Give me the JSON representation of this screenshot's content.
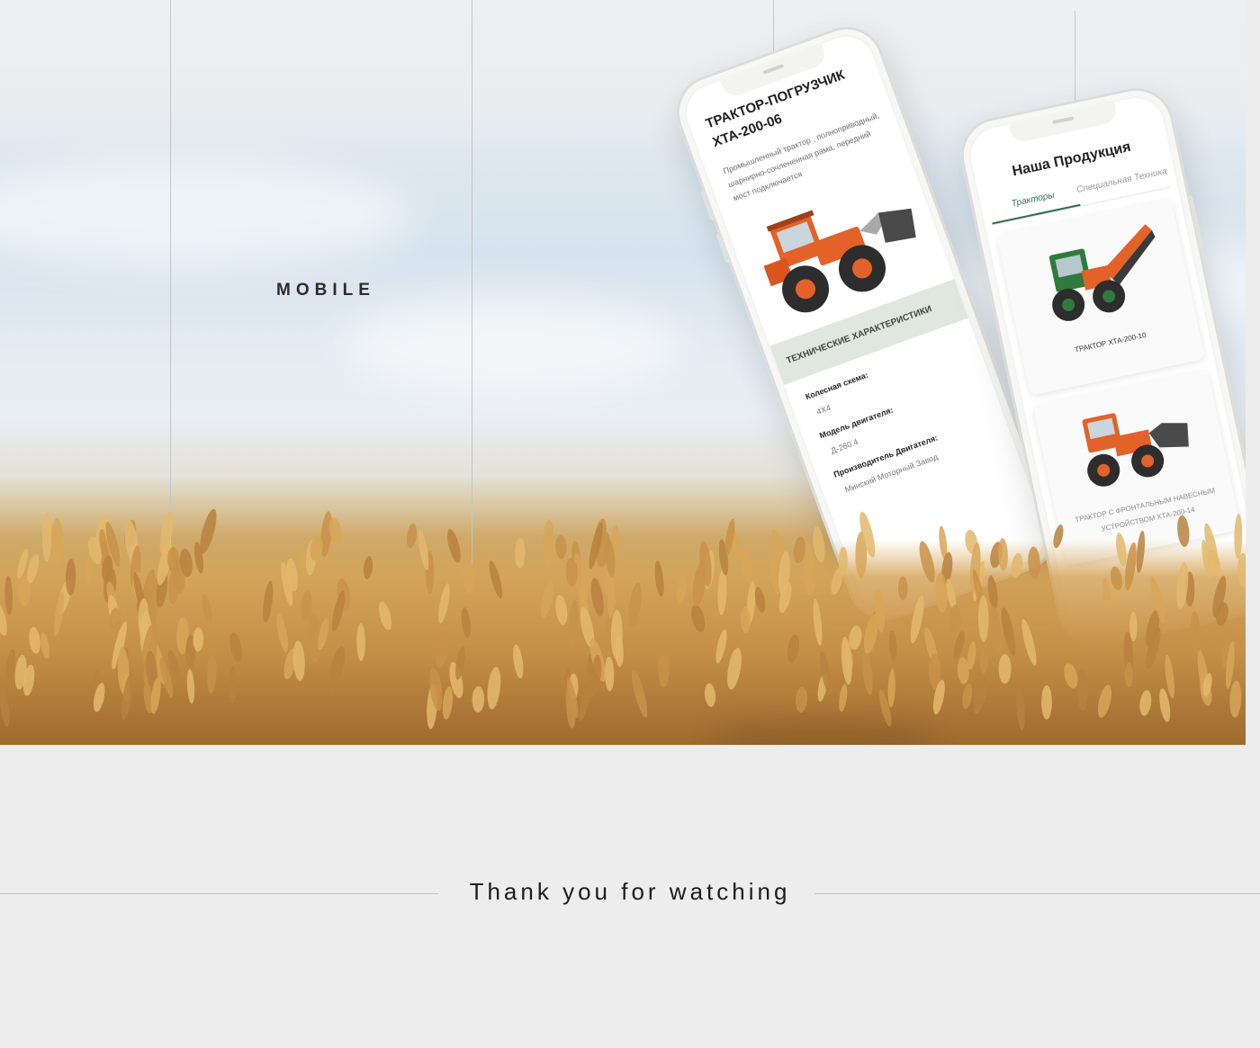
{
  "section_label": "MOBILE",
  "footer_text": "Thank you for watching",
  "phone_detail": {
    "title_line1": "ТРАКТОР-ПОГРУЗЧИК",
    "title_line2": "ХТА-200-06",
    "description": "Промышленный трактор , полноприводный, шарнирно-сочлененная рама, передний мост подключается",
    "tech_heading": "ТЕХНИЧЕСКИЕ ХАРАКТЕРИСТИКИ",
    "specs": [
      {
        "label": "Колесная схема:",
        "value": "4Х4"
      },
      {
        "label": "Модель двигателя:",
        "value": "Д-260.4"
      },
      {
        "label": "Производитель Двигателя:",
        "value": "Минский Моторный Завод"
      }
    ]
  },
  "phone_catalog": {
    "title": "Наша Продукция",
    "tabs": [
      "Тракторы",
      "Специальная Техника"
    ],
    "active_tab": "Тракторы",
    "products": [
      {
        "name": "ТРАКТОР ХТА-200-10"
      },
      {
        "name": "ТРАКТОР С ФРОНТАЛЬНЫМ НАВЕСНЫМ УСТРОЙСТВОМ ХТА-200-14"
      }
    ]
  },
  "colors": {
    "background": "#ededed",
    "accent_green": "#2f6e4a",
    "tractor_orange": "#e2622a",
    "wheat": "#c9994f"
  }
}
